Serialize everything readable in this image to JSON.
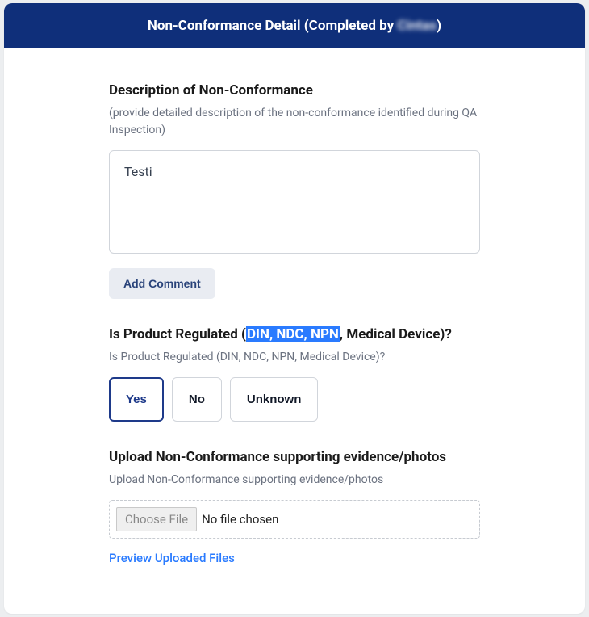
{
  "header": {
    "title_pre": "Non-Conformance Detail (Completed by ",
    "title_name": "Cintas",
    "title_post": ")"
  },
  "description": {
    "title": "Description of Non-Conformance",
    "hint": "(provide detailed description of the non-conformance identified during QA Inspection)",
    "value": "Testi",
    "add_comment_label": "Add Comment"
  },
  "regulated": {
    "title_pre": "Is Product Regulated (",
    "title_highlight": "DIN, NDC, NPN",
    "title_post": ", Medical Device)?",
    "hint": "Is Product Regulated (DIN, NDC, NPN, Medical Device)?",
    "options": {
      "yes": "Yes",
      "no": "No",
      "unknown": "Unknown"
    },
    "selected": "yes"
  },
  "upload": {
    "title": "Upload Non-Conformance supporting evidence/photos",
    "hint": "Upload Non-Conformance supporting evidence/photos",
    "choose_label": "Choose File",
    "status": "No file chosen",
    "preview_label": "Preview Uploaded Files"
  }
}
